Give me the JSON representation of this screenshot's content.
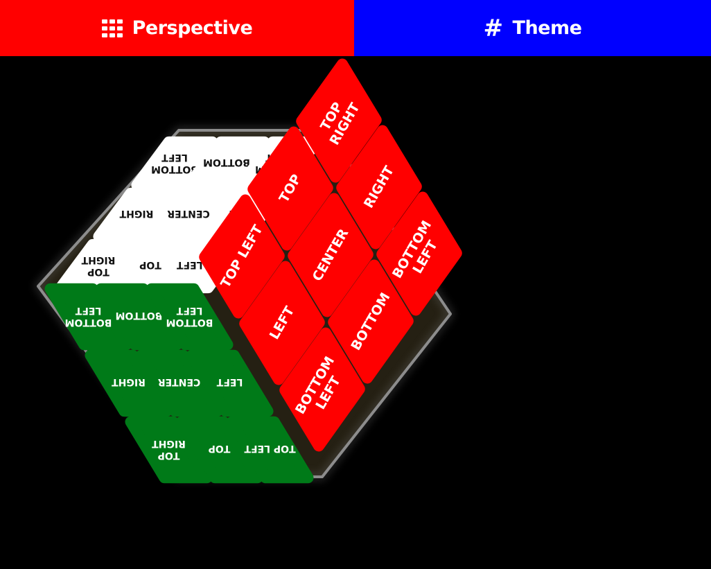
{
  "tabs": {
    "perspective": {
      "label": "Perspective",
      "icon": "grid-icon"
    },
    "theme": {
      "label": "Theme",
      "icon": "hash-icon"
    }
  },
  "colors": {
    "perspective_bg": "#ff0000",
    "theme_bg": "#0000ff",
    "page_bg": "#000000",
    "face_top": "#ffffff",
    "face_front_left": "#007a18",
    "face_front_right": "#ff0000"
  },
  "cube": {
    "top_face": {
      "color": "white",
      "stickers": [
        [
          "BOTTOM LEFT",
          "BOTTOM",
          "BOTTOM LEFT"
        ],
        [
          "RIGHT",
          "CENTER",
          "LEFT"
        ],
        [
          "TOP RIGHT",
          "TOP",
          "TOP LEFT"
        ]
      ]
    },
    "left_face": {
      "color": "green",
      "stickers": [
        [
          "BOTTOM LEFT",
          "BOTTOM",
          "BOTTOM LEFT"
        ],
        [
          "RIGHT",
          "CENTER",
          "LEFT"
        ],
        [
          "TOP RIGHT",
          "TOP",
          "TOP LEFT"
        ]
      ]
    },
    "right_face": {
      "color": "red",
      "stickers": [
        [
          "TOP LEFT",
          "TOP",
          "TOP RIGHT"
        ],
        [
          "LEFT",
          "CENTER",
          "RIGHT"
        ],
        [
          "BOTTOM LEFT",
          "BOTTOM",
          "BOTTOM LEFT"
        ]
      ]
    }
  }
}
